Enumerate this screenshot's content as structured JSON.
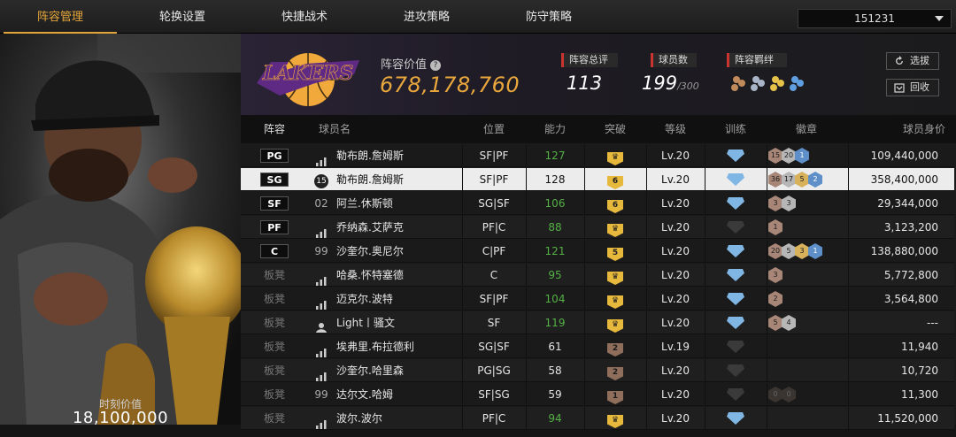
{
  "nav": {
    "tabs": [
      "阵容管理",
      "轮换设置",
      "快捷战术",
      "进攻策略",
      "防守策略"
    ],
    "active_tab": 0,
    "team_select": "151231"
  },
  "left_panel": {
    "value_label": "时刻价值",
    "value": "18,100,000"
  },
  "header": {
    "value_label": "阵容价值",
    "value": "678,178,760",
    "rating_label": "阵容总评",
    "rating": "113",
    "count_label": "球员数",
    "count": "199",
    "count_max": "/300",
    "chemistry_label": "阵容羁绊",
    "select_button": "选拔",
    "recycle_button": "回收"
  },
  "table": {
    "columns": [
      "阵容",
      "球员名",
      "位置",
      "能力",
      "突破",
      "等级",
      "训练",
      "徽章",
      "球员身价"
    ],
    "rows": [
      {
        "slot": "PG",
        "starter": true,
        "jersey": "",
        "icon": "bars",
        "name": "勒布朗.詹姆斯",
        "pos": "SF|PF",
        "ability": "127",
        "ab_green": true,
        "breakthrough": "",
        "bt_type": "gold",
        "level": "Lv.20",
        "train": "blue",
        "badges": [
          {
            "v": "15",
            "t": "bronze"
          },
          {
            "v": "20",
            "t": "silver"
          },
          {
            "v": "1",
            "t": "blue"
          }
        ],
        "price": "109,440,000"
      },
      {
        "slot": "SG",
        "starter": true,
        "jersey": "15",
        "icon": "jersey",
        "name": "勒布朗.詹姆斯",
        "pos": "SF|PF",
        "ability": "128",
        "ab_green": false,
        "breakthrough": "6",
        "bt_type": "gold",
        "level": "Lv.20",
        "train": "blue",
        "badges": [
          {
            "v": "36",
            "t": "bronze"
          },
          {
            "v": "17",
            "t": "silver"
          },
          {
            "v": "5",
            "t": "gold"
          },
          {
            "v": "2",
            "t": "blue"
          }
        ],
        "price": "358,400,000",
        "selected": true
      },
      {
        "slot": "SF",
        "starter": true,
        "jersey": "02",
        "icon": "",
        "name": "阿兰.休斯顿",
        "pos": "SG|SF",
        "ability": "106",
        "ab_green": true,
        "breakthrough": "6",
        "bt_type": "gold",
        "level": "Lv.20",
        "train": "blue",
        "badges": [
          {
            "v": "3",
            "t": "bronze"
          },
          {
            "v": "3",
            "t": "silver"
          }
        ],
        "price": "29,344,000"
      },
      {
        "slot": "PF",
        "starter": true,
        "jersey": "",
        "icon": "bars",
        "name": "乔纳森.艾萨克",
        "pos": "PF|C",
        "ability": "88",
        "ab_green": true,
        "breakthrough": "",
        "bt_type": "gold",
        "level": "Lv.20",
        "train": "gray",
        "badges": [
          {
            "v": "1",
            "t": "bronze"
          }
        ],
        "price": "3,123,200"
      },
      {
        "slot": "C",
        "starter": true,
        "jersey": "99",
        "icon": "",
        "name": "沙奎尔.奥尼尔",
        "pos": "C|PF",
        "ability": "121",
        "ab_green": true,
        "breakthrough": "5",
        "bt_type": "gold",
        "level": "Lv.20",
        "train": "blue",
        "badges": [
          {
            "v": "20",
            "t": "bronze"
          },
          {
            "v": "5",
            "t": "silver"
          },
          {
            "v": "3",
            "t": "gold"
          },
          {
            "v": "1",
            "t": "blue"
          }
        ],
        "price": "138,880,000"
      },
      {
        "slot": "板凳",
        "starter": false,
        "jersey": "",
        "icon": "bars",
        "name": "哈桑.怀特塞德",
        "pos": "C",
        "ability": "95",
        "ab_green": true,
        "breakthrough": "",
        "bt_type": "gold",
        "level": "Lv.20",
        "train": "blue",
        "badges": [
          {
            "v": "3",
            "t": "bronze"
          }
        ],
        "price": "5,772,800"
      },
      {
        "slot": "板凳",
        "starter": false,
        "jersey": "",
        "icon": "bars",
        "name": "迈克尔.波特",
        "pos": "SF|PF",
        "ability": "104",
        "ab_green": true,
        "breakthrough": "",
        "bt_type": "gold",
        "level": "Lv.20",
        "train": "blue",
        "badges": [
          {
            "v": "2",
            "t": "bronze"
          }
        ],
        "price": "3,564,800"
      },
      {
        "slot": "板凳",
        "starter": false,
        "jersey": "",
        "icon": "person",
        "name": "Light丨骚文",
        "pos": "SF",
        "ability": "119",
        "ab_green": true,
        "breakthrough": "",
        "bt_type": "gold",
        "level": "Lv.20",
        "train": "blue",
        "badges": [
          {
            "v": "5",
            "t": "bronze"
          },
          {
            "v": "4",
            "t": "silver"
          }
        ],
        "price": "---"
      },
      {
        "slot": "板凳",
        "starter": false,
        "jersey": "",
        "icon": "bars",
        "name": "埃弗里.布拉德利",
        "pos": "SG|SF",
        "ability": "61",
        "ab_green": false,
        "breakthrough": "2",
        "bt_type": "brown",
        "level": "Lv.19",
        "train": "gray",
        "badges": [],
        "price": "11,940"
      },
      {
        "slot": "板凳",
        "starter": false,
        "jersey": "",
        "icon": "bars",
        "name": "沙奎尔.哈里森",
        "pos": "PG|SG",
        "ability": "58",
        "ab_green": false,
        "breakthrough": "2",
        "bt_type": "brown",
        "level": "Lv.20",
        "train": "gray",
        "badges": [],
        "price": "10,720"
      },
      {
        "slot": "板凳",
        "starter": false,
        "jersey": "99",
        "icon": "",
        "name": "达尔文.哈姆",
        "pos": "SF|SG",
        "ability": "59",
        "ab_green": false,
        "breakthrough": "1",
        "bt_type": "brown",
        "level": "Lv.20",
        "train": "gray",
        "badges": [
          {
            "v": "0",
            "t": "dark"
          },
          {
            "v": "0",
            "t": "dark"
          }
        ],
        "price": "11,300"
      },
      {
        "slot": "板凳",
        "starter": false,
        "jersey": "",
        "icon": "bars",
        "name": "波尔.波尔",
        "pos": "PF|C",
        "ability": "94",
        "ab_green": true,
        "breakthrough": "",
        "bt_type": "gold",
        "level": "Lv.20",
        "train": "blue",
        "badges": [],
        "price": "11,520,000"
      }
    ]
  },
  "colors": {
    "accent_gold": "#e3a53a",
    "ability_green": "#55b046",
    "stat_red": "#c9352e"
  }
}
